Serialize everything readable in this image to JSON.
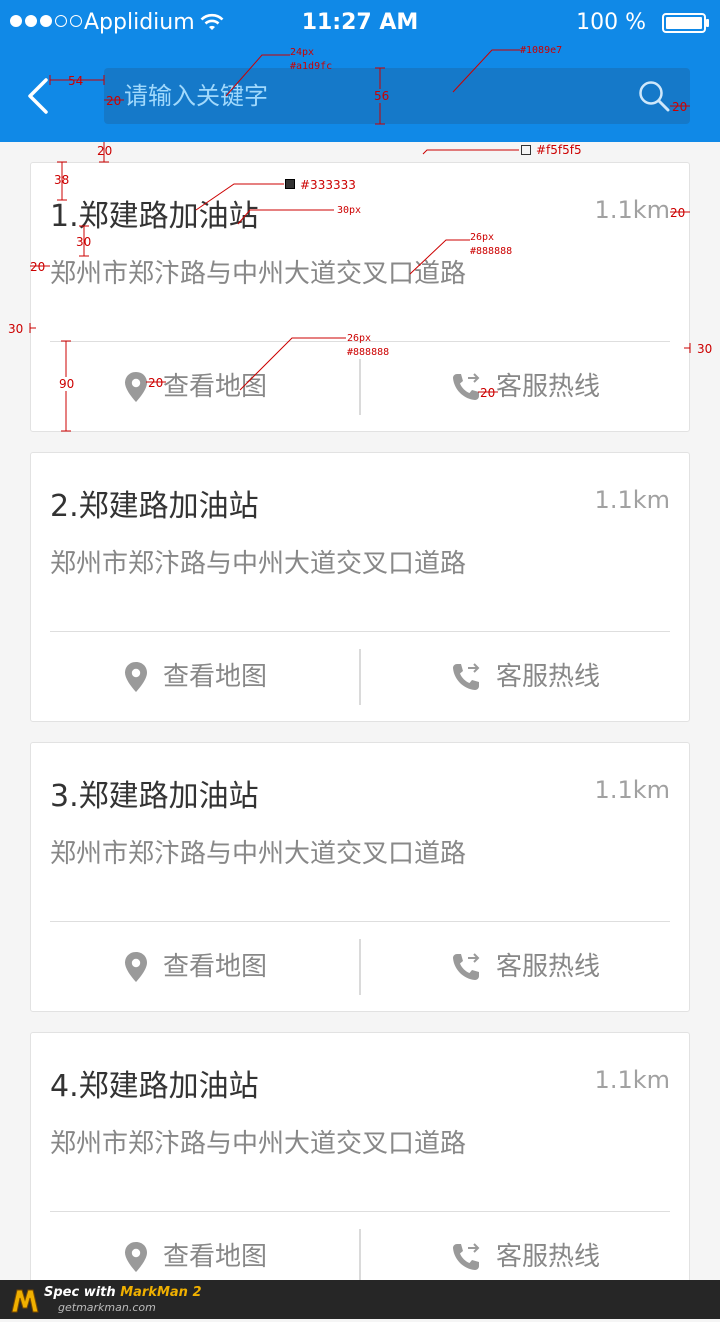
{
  "status_bar": {
    "carrier": "Applidium",
    "time": "11:27 AM",
    "battery": "100 %"
  },
  "nav": {
    "back_icon": "chevron-left-icon",
    "search": {
      "placeholder": "请输入关键字",
      "value": ""
    },
    "search_icon": "magnifier-icon"
  },
  "colors": {
    "header_bg": "#1089e7",
    "page_bg": "#f5f5f5",
    "placeholder": "#a1d9fc",
    "title_text": "#333333",
    "secondary_text": "#888888"
  },
  "stations": [
    {
      "name": "1.郑建路加油站",
      "distance": "1.1km",
      "address": "郑州市郑汴路与中州大道交叉口道路",
      "map_label": "查看地图",
      "hotline_label": "客服热线"
    },
    {
      "name": "2.郑建路加油站",
      "distance": "1.1km",
      "address": "郑州市郑汴路与中州大道交叉口道路",
      "map_label": "查看地图",
      "hotline_label": "客服热线"
    },
    {
      "name": "3.郑建路加油站",
      "distance": "1.1km",
      "address": "郑州市郑汴路与中州大道交叉口道路",
      "map_label": "查看地图",
      "hotline_label": "客服热线"
    },
    {
      "name": "4.郑建路加油站",
      "distance": "1.1km",
      "address": "郑州市郑汴路与中州大道交叉口道路",
      "map_label": "查看地图",
      "hotline_label": "客服热线"
    }
  ],
  "annotations": {
    "back_gap": "54",
    "search_left_pad": "20",
    "font_24": "24px",
    "color_placeholder": "#a1d9fc",
    "height_56": "56",
    "color_header": "#1089e7",
    "search_right_pad": "20",
    "top_gap": "20",
    "color_bg": "#f5f5f5",
    "title_top": "38",
    "color_title": "#333333",
    "font_30": "30px",
    "right_pad": "20",
    "line_gap": "30",
    "font_26": "26px",
    "color_gray": "#888888",
    "left_pad": "20",
    "side_margin_left": "30",
    "side_margin_right": "30",
    "action_height": "90",
    "icon_gap": "20",
    "font_26b": "26px",
    "color_grayb": "#888888",
    "icon_gap_b": "20"
  },
  "footer": {
    "title_prefix": "Spec with ",
    "title_brand": "MarkMan 2",
    "url": "getmarkman.com"
  }
}
